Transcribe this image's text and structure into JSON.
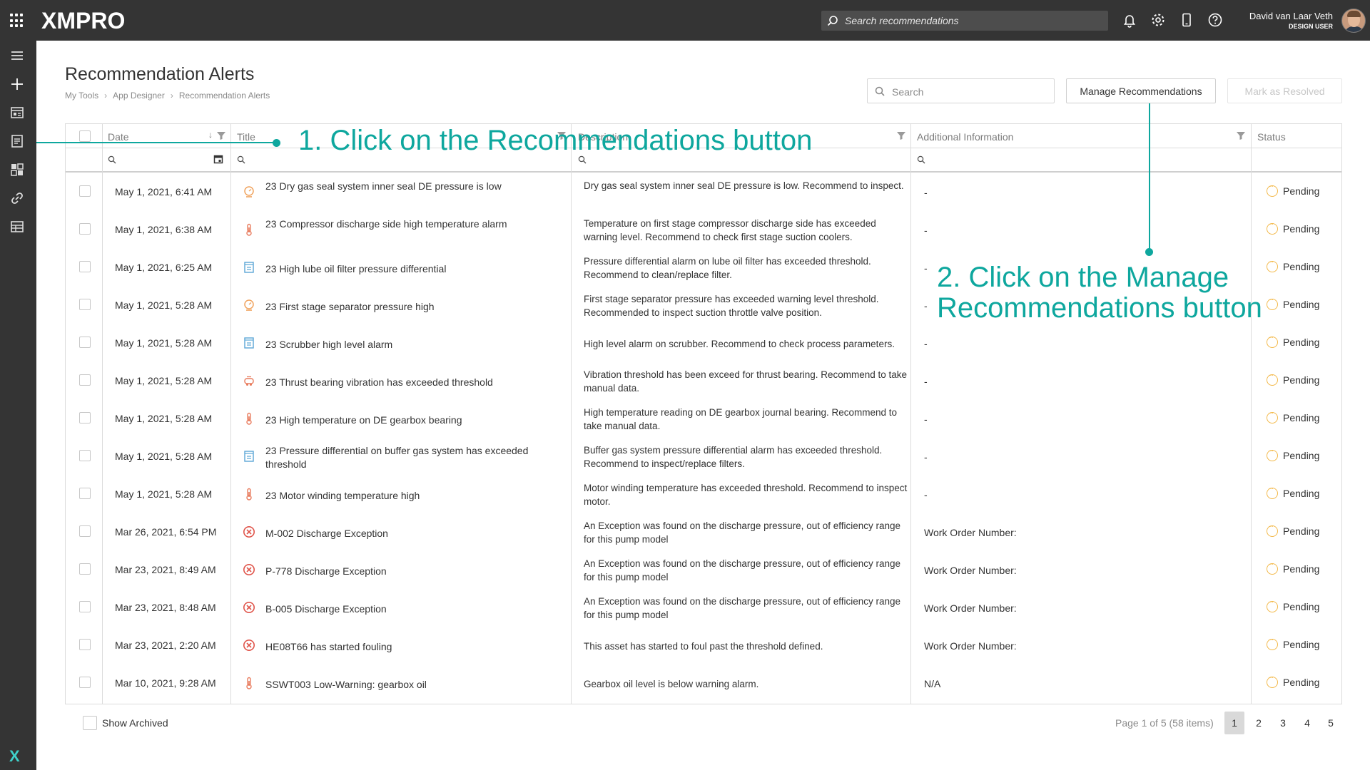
{
  "app": {
    "brand": "XMPRO",
    "top_search_placeholder": "Search recommendations",
    "user_name": "David van Laar Veth",
    "user_role": "DESIGN USER"
  },
  "header": {
    "title": "Recommendation Alerts",
    "breadcrumb": [
      "My Tools",
      "App Designer",
      "Recommendation Alerts"
    ],
    "search_placeholder": "Search",
    "manage_button": "Manage Recommendations",
    "resolve_button": "Mark as Resolved"
  },
  "table": {
    "columns": [
      "Date",
      "Title",
      "Description",
      "Additional Information",
      "Status"
    ],
    "rows": [
      {
        "date": "May 1, 2021, 6:41 AM",
        "icon": "pressure-gauge-icon",
        "title": "23 Dry gas seal system inner seal DE pressure is low",
        "desc": "Dry gas seal system inner seal DE pressure is low. Recommend to inspect.",
        "info": "-",
        "status": "Pending"
      },
      {
        "date": "May 1, 2021, 6:38 AM",
        "icon": "thermometer-icon",
        "title": "23 Compressor discharge side high temperature alarm",
        "desc": "Temperature on first stage compressor discharge side has exceeded warning level. Recommend to check first stage suction coolers.",
        "info": "-",
        "status": "Pending"
      },
      {
        "date": "May 1, 2021, 6:25 AM",
        "icon": "filter-icon",
        "title": "23 High lube oil filter pressure differential",
        "desc": "Pressure differential alarm on lube oil filter has exceeded threshold. Recommend to clean/replace filter.",
        "info": "-",
        "status": "Pending"
      },
      {
        "date": "May 1, 2021, 5:28 AM",
        "icon": "pressure-gauge-icon",
        "title": "23 First stage separator pressure high",
        "desc": "First stage separator pressure has exceeded warning level threshold. Recommended to inspect suction throttle valve position.",
        "info": "-",
        "status": "Pending"
      },
      {
        "date": "May 1, 2021, 5:28 AM",
        "icon": "filter-icon",
        "title": "23 Scrubber high level alarm",
        "desc": "High level alarm on scrubber. Recommend to check process parameters.",
        "info": "-",
        "status": "Pending"
      },
      {
        "date": "May 1, 2021, 5:28 AM",
        "icon": "vibration-icon",
        "title": "23 Thrust bearing vibration has exceeded threshold",
        "desc": "Vibration threshold has been exceed for thrust bearing. Recommend to take manual data.",
        "info": "-",
        "status": "Pending"
      },
      {
        "date": "May 1, 2021, 5:28 AM",
        "icon": "thermometer-icon",
        "title": "23 High temperature on DE gearbox bearing",
        "desc": "High temperature reading on DE gearbox journal bearing. Recommend to take manual data.",
        "info": "-",
        "status": "Pending"
      },
      {
        "date": "May 1, 2021, 5:28 AM",
        "icon": "filter-icon",
        "title": "23 Pressure differential on buffer gas system has exceeded threshold",
        "desc": "Buffer gas system pressure differential alarm has exceeded threshold. Recommend to inspect/replace filters.",
        "info": "-",
        "status": "Pending"
      },
      {
        "date": "May 1, 2021, 5:28 AM",
        "icon": "thermometer-icon",
        "title": "23 Motor winding temperature high",
        "desc": "Motor winding temperature has exceeded threshold. Recommend to inspect motor.",
        "info": "-",
        "status": "Pending"
      },
      {
        "date": "Mar 26, 2021, 6:54 PM",
        "icon": "error-circle-icon",
        "title": "M-002 Discharge Exception",
        "desc": "An Exception was found on the discharge pressure, out of efficiency range for this pump model",
        "info": "Work Order Number:",
        "status": "Pending"
      },
      {
        "date": "Mar 23, 2021, 8:49 AM",
        "icon": "error-circle-icon",
        "title": "P-778 Discharge Exception",
        "desc": "An Exception was found on the discharge pressure, out of efficiency range for this pump model",
        "info": "Work Order Number:",
        "status": "Pending"
      },
      {
        "date": "Mar 23, 2021, 8:48 AM",
        "icon": "error-circle-icon",
        "title": "B-005 Discharge Exception",
        "desc": "An Exception was found on the discharge pressure, out of efficiency range for this pump model",
        "info": "Work Order Number:",
        "status": "Pending"
      },
      {
        "date": "Mar 23, 2021, 2:20 AM",
        "icon": "error-circle-icon",
        "title": "HE08T66 has started fouling",
        "desc": "This asset has started to foul past the threshold defined.",
        "info": "Work Order Number:",
        "status": "Pending"
      },
      {
        "date": "Mar 10, 2021, 9:28 AM",
        "icon": "thermometer-icon",
        "title": "SSWT003 Low-Warning: gearbox oil",
        "desc": "Gearbox oil level is below warning alarm.",
        "info": "N/A",
        "status": "Pending"
      }
    ]
  },
  "footer": {
    "show_archived": "Show Archived",
    "page_info": "Page 1 of 5 (58 items)",
    "pages": [
      "1",
      "2",
      "3",
      "4",
      "5"
    ]
  },
  "annotations": {
    "step1": "1. Click on the Recommendations button",
    "step2_line1": "2. Click on the Manage",
    "step2_line2": "Recommendations button"
  },
  "colors": {
    "accent": "#0ea79e",
    "topbar": "#343434",
    "pending": "#f3b94a",
    "error": "#e0554b",
    "icon_orange": "#f0a35e",
    "icon_blue": "#5aa6d6"
  }
}
